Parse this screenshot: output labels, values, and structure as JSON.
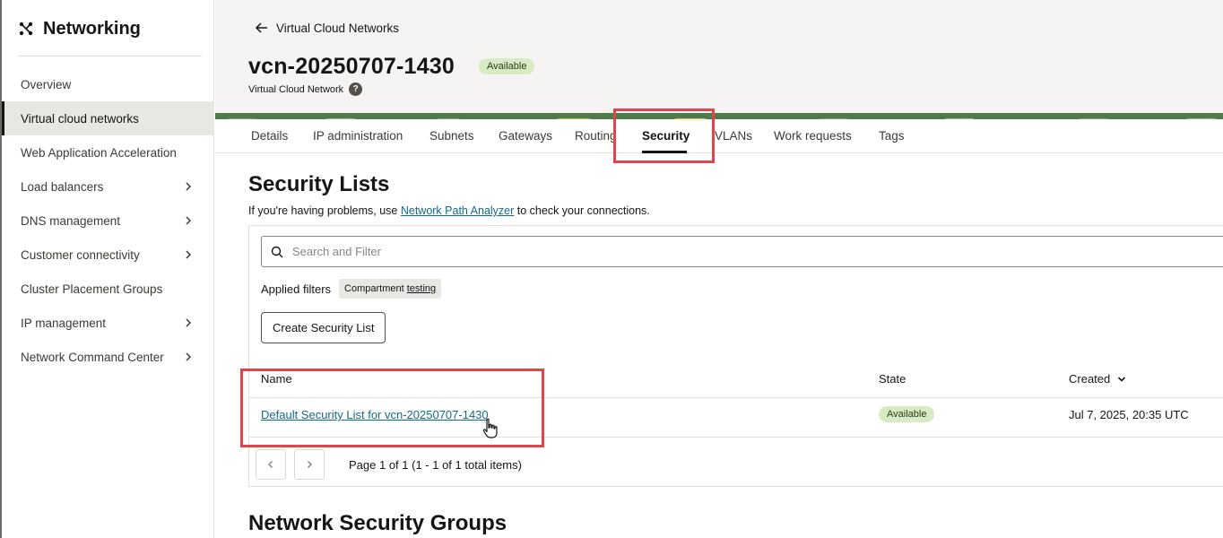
{
  "sidebar": {
    "title": "Networking",
    "items": [
      {
        "label": "Overview",
        "has_children": false,
        "active": false
      },
      {
        "label": "Virtual cloud networks",
        "has_children": false,
        "active": true
      },
      {
        "label": "Web Application Acceleration",
        "has_children": false,
        "active": false
      },
      {
        "label": "Load balancers",
        "has_children": true,
        "active": false
      },
      {
        "label": "DNS management",
        "has_children": true,
        "active": false
      },
      {
        "label": "Customer connectivity",
        "has_children": true,
        "active": false
      },
      {
        "label": "Cluster Placement Groups",
        "has_children": false,
        "active": false
      },
      {
        "label": "IP management",
        "has_children": true,
        "active": false
      },
      {
        "label": "Network Command Center",
        "has_children": true,
        "active": false
      }
    ]
  },
  "header": {
    "back_label": "Virtual Cloud Networks",
    "title": "vcn-20250707-1430",
    "status": "Available",
    "subtitle": "Virtual Cloud Network",
    "help": "?"
  },
  "tabs": {
    "items": [
      "Details",
      "IP administration",
      "Subnets",
      "Gateways",
      "Routing",
      "Security",
      "VLANs",
      "Work requests",
      "Tags"
    ],
    "active": "Security"
  },
  "security_lists": {
    "heading": "Security Lists",
    "intro_before": "If you're having problems, use ",
    "intro_link": "Network Path Analyzer",
    "intro_after": " to check your connections.",
    "search_placeholder": "Search and Filter",
    "applied_filters_label": "Applied filters",
    "filter_chip_key": "Compartment",
    "filter_chip_value": "testing",
    "create_button": "Create Security List",
    "columns": {
      "name": "Name",
      "state": "State",
      "created": "Created"
    },
    "rows": [
      {
        "name": "Default Security List for vcn-20250707-1430",
        "state": "Available",
        "created": "Jul 7, 2025, 20:35 UTC"
      }
    ],
    "pagination": "Page 1 of 1 (1 - 1 of 1 total items)"
  },
  "nsg": {
    "heading": "Network Security Groups"
  },
  "colors": {
    "link": "#136b85",
    "available_badge_bg": "#d8ebc4",
    "highlight": "#e0454b",
    "banner": "#4f7a4a"
  }
}
